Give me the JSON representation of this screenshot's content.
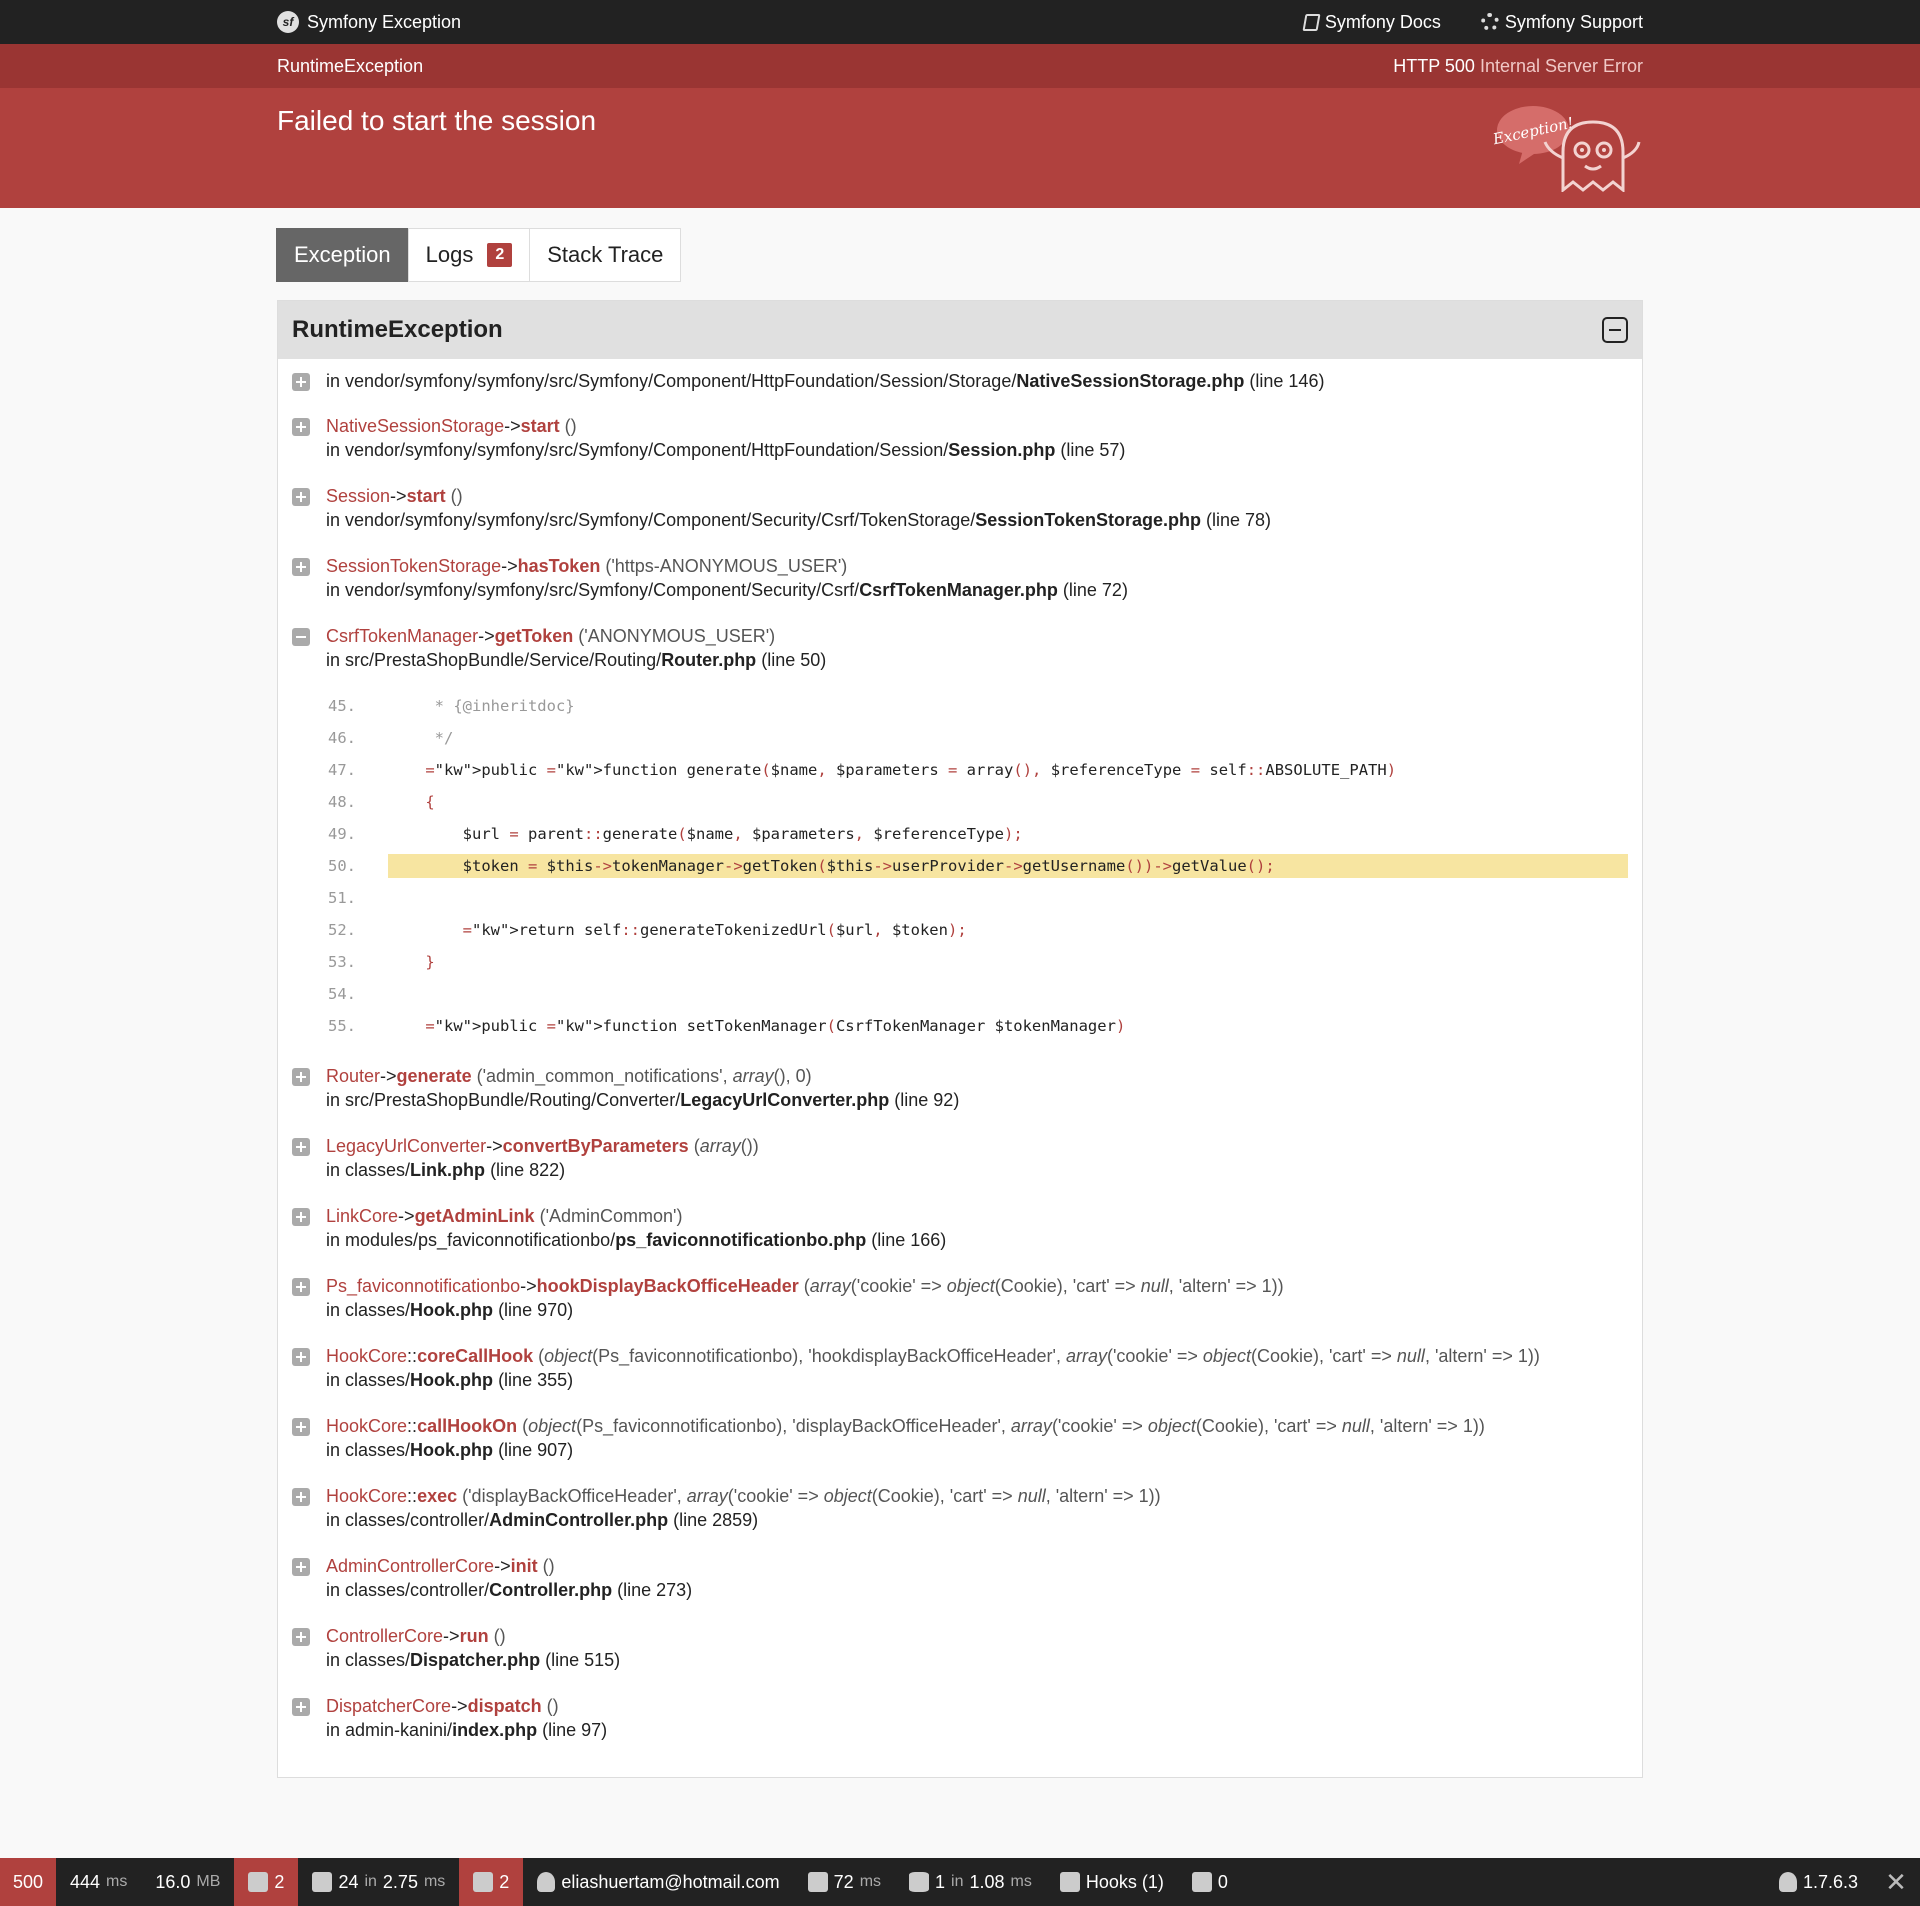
{
  "header": {
    "brand": "Symfony Exception",
    "docs_label": "Symfony Docs",
    "support_label": "Symfony Support"
  },
  "summary": {
    "exception_class": "RuntimeException",
    "http_code": "HTTP 500",
    "http_text": "Internal Server Error",
    "message": "Failed to start the session",
    "illustration_text": "Exception!"
  },
  "tabs": [
    {
      "label": "Exception"
    },
    {
      "label": "Logs",
      "badge": "2"
    },
    {
      "label": "Stack Trace"
    }
  ],
  "trace": {
    "class": "RuntimeException",
    "first": {
      "prefix": "in vendor/symfony/symfony/src/Symfony/Component/HttpFoundation/Session/Storage/",
      "file": "NativeSessionStorage.php",
      "line": "(line 146)"
    },
    "frames": [
      {
        "cls": "NativeSessionStorage",
        "op": "->",
        "fn": "start",
        "args": "()",
        "path": "in vendor/symfony/symfony/src/Symfony/Component/HttpFoundation/Session/",
        "file": "Session.php",
        "line": "(line 57)"
      },
      {
        "cls": "Session",
        "op": "->",
        "fn": "start",
        "args": "()",
        "path": "in vendor/symfony/symfony/src/Symfony/Component/Security/Csrf/TokenStorage/",
        "file": "SessionTokenStorage.php",
        "line": "(line 78)"
      },
      {
        "cls": "SessionTokenStorage",
        "op": "->",
        "fn": "hasToken",
        "args": "('https-ANONYMOUS_USER')",
        "path": "in vendor/symfony/symfony/src/Symfony/Component/Security/Csrf/",
        "file": "CsrfTokenManager.php",
        "line": "(line 72)"
      }
    ],
    "expanded": {
      "cls": "CsrfTokenManager",
      "op": "->",
      "fn": "getToken",
      "args": "('ANONYMOUS_USER')",
      "path": "in src/PrestaShopBundle/Service/Routing/",
      "file": "Router.php",
      "line": "(line 50)"
    },
    "code": [
      {
        "n": "45.",
        "text": "     * {@inheritdoc}"
      },
      {
        "n": "46.",
        "text": "     */"
      },
      {
        "n": "47.",
        "text": "    public function generate($name, $parameters = array(), $referenceType = self::ABSOLUTE_PATH)"
      },
      {
        "n": "48.",
        "text": "    {"
      },
      {
        "n": "49.",
        "text": "        $url = parent::generate($name, $parameters, $referenceType);"
      },
      {
        "n": "50.",
        "text": "        $token = $this->tokenManager->getToken($this->userProvider->getUsername())->getValue();"
      },
      {
        "n": "51.",
        "text": ""
      },
      {
        "n": "52.",
        "text": "        return self::generateTokenizedUrl($url, $token);"
      },
      {
        "n": "53.",
        "text": "    }"
      },
      {
        "n": "54.",
        "text": ""
      },
      {
        "n": "55.",
        "text": "    public function setTokenManager(CsrfTokenManager $tokenManager)"
      }
    ],
    "frames2": [
      {
        "cls": "Router",
        "op": "->",
        "fn": "generate",
        "args": "('admin_common_notifications', array(), 0)",
        "path": "in src/PrestaShopBundle/Routing/Converter/",
        "file": "LegacyUrlConverter.php",
        "line": "(line 92)"
      },
      {
        "cls": "LegacyUrlConverter",
        "op": "->",
        "fn": "convertByParameters",
        "args": "(array())",
        "path": "in classes/",
        "file": "Link.php",
        "line": "(line 822)"
      },
      {
        "cls": "LinkCore",
        "op": "->",
        "fn": "getAdminLink",
        "args": "('AdminCommon')",
        "path": "in modules/ps_faviconnotificationbo/",
        "file": "ps_faviconnotificationbo.php",
        "line": "(line 166)"
      },
      {
        "cls": "Ps_faviconnotificationbo",
        "op": "->",
        "fn": "hookDisplayBackOfficeHeader",
        "args": "(array('cookie' => object(Cookie), 'cart' => null, 'altern' => 1))",
        "path": "in classes/",
        "file": "Hook.php",
        "line": "(line 970)"
      },
      {
        "cls": "HookCore",
        "op": "::",
        "fn": "coreCallHook",
        "args": "(object(Ps_faviconnotificationbo), 'hookdisplayBackOfficeHeader', array('cookie' => object(Cookie), 'cart' => null, 'altern' => 1))",
        "path": "in classes/",
        "file": "Hook.php",
        "line": "(line 355)"
      },
      {
        "cls": "HookCore",
        "op": "::",
        "fn": "callHookOn",
        "args": "(object(Ps_faviconnotificationbo), 'displayBackOfficeHeader', array('cookie' => object(Cookie), 'cart' => null, 'altern' => 1))",
        "path": "in classes/",
        "file": "Hook.php",
        "line": "(line 907)"
      },
      {
        "cls": "HookCore",
        "op": "::",
        "fn": "exec",
        "args": "('displayBackOfficeHeader', array('cookie' => object(Cookie), 'cart' => null, 'altern' => 1))",
        "path": "in classes/controller/",
        "file": "AdminController.php",
        "line": "(line 2859)"
      },
      {
        "cls": "AdminControllerCore",
        "op": "->",
        "fn": "init",
        "args": "()",
        "path": "in classes/controller/",
        "file": "Controller.php",
        "line": "(line 273)"
      },
      {
        "cls": "ControllerCore",
        "op": "->",
        "fn": "run",
        "args": "()",
        "path": "in classes/",
        "file": "Dispatcher.php",
        "line": "(line 515)"
      },
      {
        "cls": "DispatcherCore",
        "op": "->",
        "fn": "dispatch",
        "args": "()",
        "path": "in admin-kanini/",
        "file": "index.php",
        "line": "(line 97)"
      }
    ]
  },
  "toolbar": {
    "status": "500",
    "time": "444",
    "time_unit": "ms",
    "memory": "16.0",
    "memory_unit": "MB",
    "logs_count": "2",
    "cache_count": "24",
    "cache_in": "in",
    "cache_time": "2.75",
    "cache_unit": "ms",
    "translation_count": "2",
    "user": "eliashuertam@hotmail.com",
    "twig_time": "72",
    "twig_unit": "ms",
    "db_count": "1",
    "db_in": "in",
    "db_time": "1.08",
    "db_unit": "ms",
    "hooks": "Hooks (1)",
    "modules": "0",
    "version": "1.7.6.3",
    "close": "✕"
  }
}
